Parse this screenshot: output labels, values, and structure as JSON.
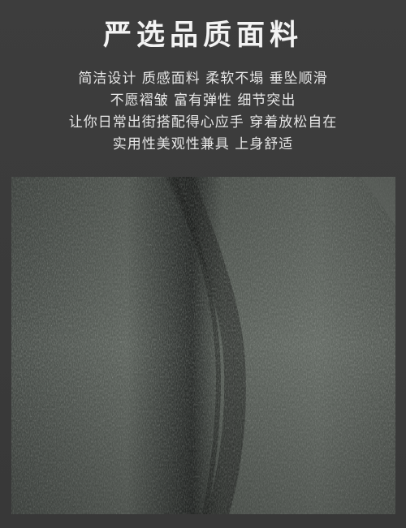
{
  "heading": {
    "title": "严选品质面料"
  },
  "description": {
    "lines": [
      "简洁设计 质感面料 柔软不塌 垂坠顺滑",
      "不愿褶皱 富有弹性 细节突出",
      "让你日常出街搭配得心应手 穿着放松自在",
      "实用性美观性兼具 上身舒适"
    ]
  },
  "photo": {
    "subject": "chenille-fabric-closeup",
    "colors": {
      "base": "#5a605a",
      "shadow": "#2f3330",
      "highlight": "#9aa29a"
    }
  },
  "colors": {
    "background": "#3a3a3a",
    "text": "#f3f3f3"
  }
}
